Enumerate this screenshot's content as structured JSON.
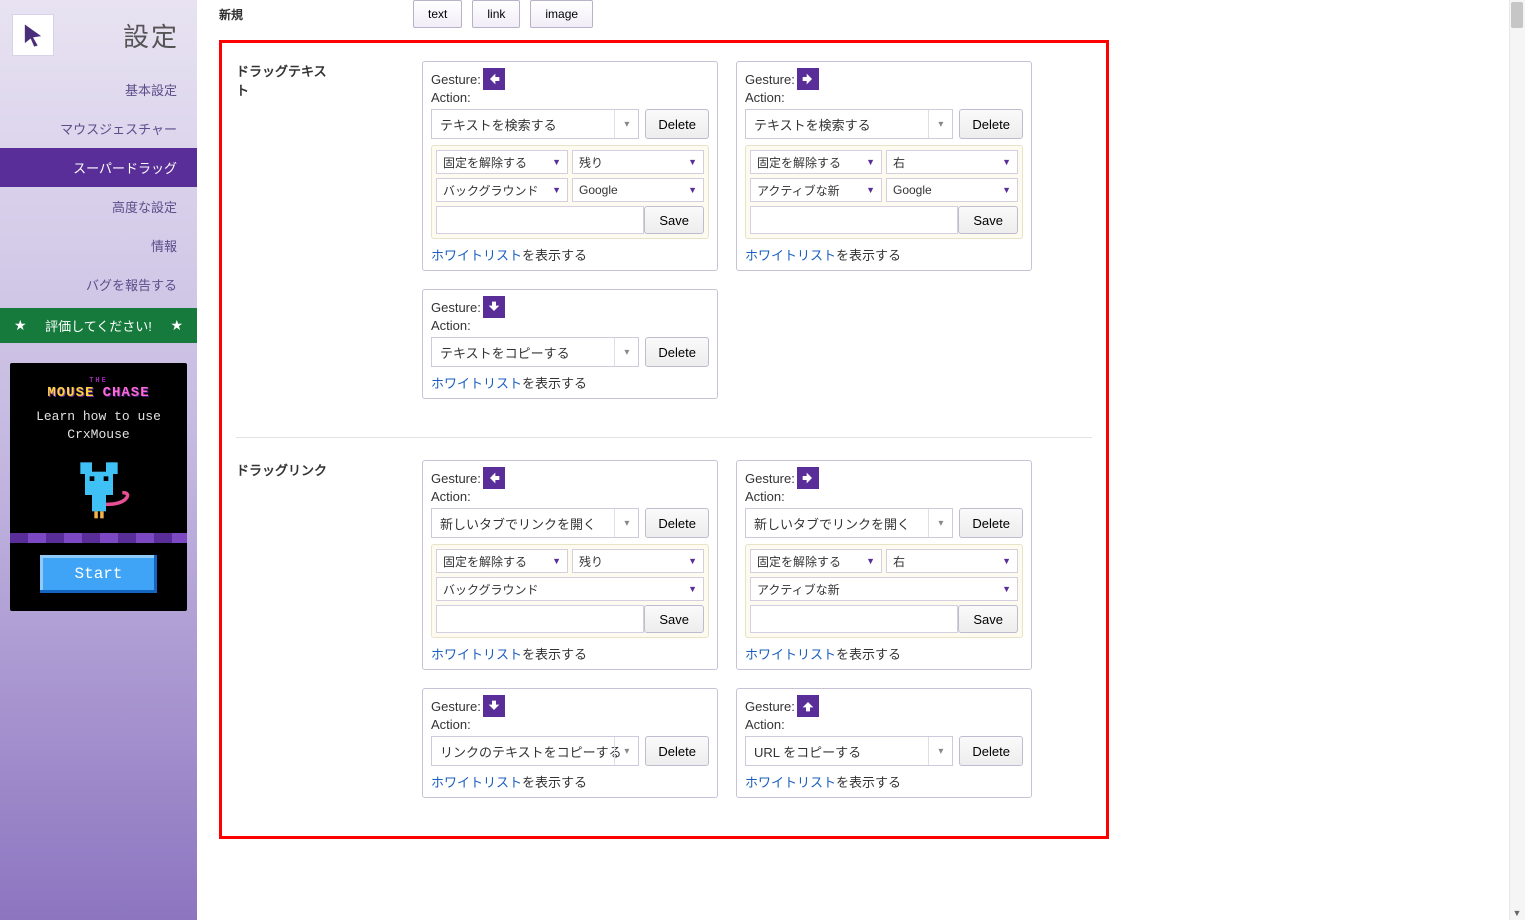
{
  "app_title": "設定",
  "nav": {
    "basic": "基本設定",
    "gesture": "マウスジェスチャー",
    "superdrag": "スーパードラッグ",
    "advanced": "高度な設定",
    "info": "情報",
    "bug": "バグを報告する",
    "rate": "評価してください!"
  },
  "promo": {
    "the": "THE",
    "mouse": "MOUSE",
    "chase": "CHASE",
    "learn": "Learn how to use CrxMouse",
    "start": "Start"
  },
  "top": {
    "new_label": "新規",
    "tabs": {
      "text": "text",
      "link": "link",
      "image": "image"
    }
  },
  "labels": {
    "gesture": "Gesture:",
    "action": "Action:",
    "delete": "Delete",
    "save": "Save",
    "whitelist_link": "ホワイトリスト",
    "whitelist_tail": "を表示する"
  },
  "sections": {
    "drag_text": {
      "title": "ドラッグテキスト",
      "cards": [
        {
          "dir": "left",
          "action": "テキストを検索する",
          "opts": [
            [
              "固定を解除する",
              "残り"
            ],
            [
              "バックグラウンド",
              "Google"
            ]
          ],
          "save": true
        },
        {
          "dir": "right",
          "action": "テキストを検索する",
          "opts": [
            [
              "固定を解除する",
              "右"
            ],
            [
              "アクティブな新",
              "Google"
            ]
          ],
          "save": true
        },
        {
          "dir": "down",
          "action": "テキストをコピーする"
        }
      ]
    },
    "drag_link": {
      "title": "ドラッグリンク",
      "cards": [
        {
          "dir": "left",
          "action": "新しいタブでリンクを開く",
          "opts": [
            [
              "固定を解除する",
              "残り"
            ],
            [
              "バックグラウンド"
            ]
          ],
          "save": true
        },
        {
          "dir": "right",
          "action": "新しいタブでリンクを開く",
          "opts": [
            [
              "固定を解除する",
              "右"
            ],
            [
              "アクティブな新"
            ]
          ],
          "save": true
        },
        {
          "dir": "down",
          "action": "リンクのテキストをコピーする"
        },
        {
          "dir": "up",
          "action": "URL をコピーする"
        }
      ]
    }
  }
}
